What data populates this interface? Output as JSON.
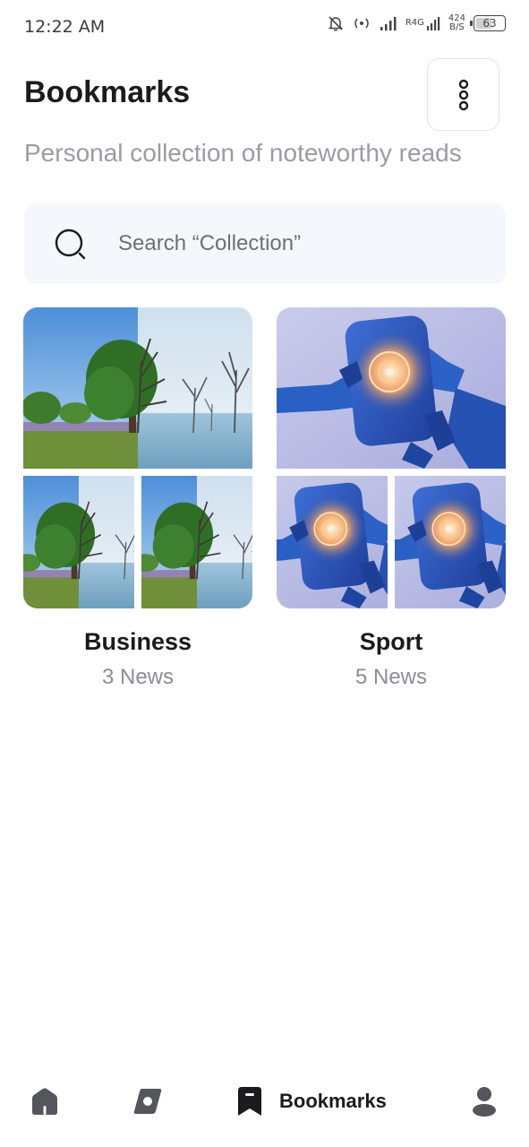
{
  "status_bar": {
    "time": "12:22 AM",
    "network_type": "R4G",
    "speed_value": "424",
    "speed_unit": "B/S",
    "battery": "63",
    "battery_level_percent": 63
  },
  "header": {
    "title": "Bookmarks",
    "subtitle": "Personal collection of noteworthy reads",
    "menu_icon": "more-vertical-icon"
  },
  "search": {
    "placeholder": "Search “Collection”",
    "value": ""
  },
  "collections": [
    {
      "name": "Business",
      "count_label": "3 News",
      "image": "tree-seasons-photo"
    },
    {
      "name": "Sport",
      "count_label": "5 News",
      "image": "robot-hands-photo"
    }
  ],
  "bottom_nav": {
    "items": [
      {
        "id": "home",
        "icon": "home-icon",
        "label": ""
      },
      {
        "id": "discover",
        "icon": "compass-icon",
        "label": ""
      },
      {
        "id": "bookmarks",
        "icon": "bookmark-icon",
        "label": "Bookmarks",
        "active": true
      },
      {
        "id": "profile",
        "icon": "profile-icon",
        "label": ""
      }
    ]
  },
  "colors": {
    "text_primary": "#1b1b1f",
    "text_secondary": "#9b9ba3",
    "search_bg": "#f4f8fd",
    "border": "#e3e3e8"
  }
}
